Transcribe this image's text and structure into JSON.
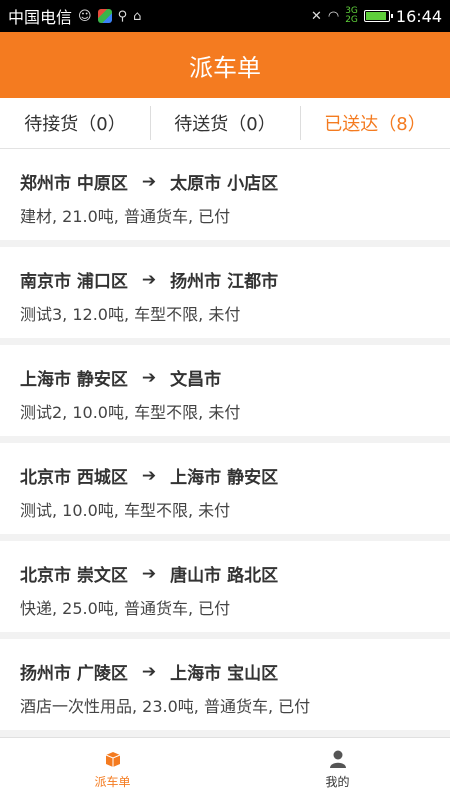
{
  "status_bar": {
    "carrier": "中国电信",
    "time": "16:44",
    "network": [
      "3G",
      "2G"
    ]
  },
  "header": {
    "title": "派车单"
  },
  "tabs": [
    {
      "label": "待接货（0）",
      "active": false
    },
    {
      "label": "待送货（0）",
      "active": false
    },
    {
      "label": "已送达（8）",
      "active": true
    }
  ],
  "orders": [
    {
      "from": "郑州市 中原区",
      "to": "太原市 小店区",
      "detail": "建材, 21.0吨, 普通货车, 已付"
    },
    {
      "from": "南京市 浦口区",
      "to": "扬州市 江都市",
      "detail": "测试3, 12.0吨, 车型不限, 未付"
    },
    {
      "from": "上海市 静安区",
      "to": "文昌市",
      "detail": "测试2, 10.0吨, 车型不限, 未付"
    },
    {
      "from": "北京市 西城区",
      "to": "上海市 静安区",
      "detail": "测试, 10.0吨, 车型不限, 未付"
    },
    {
      "from": "北京市 崇文区",
      "to": "唐山市 路北区",
      "detail": "快递, 25.0吨, 普通货车, 已付"
    },
    {
      "from": "扬州市 广陵区",
      "to": "上海市 宝山区",
      "detail": "酒店一次性用品, 23.0吨, 普通货车, 已付"
    }
  ],
  "arrow": "➔",
  "bottom_nav": [
    {
      "label": "派车单",
      "icon": "truck-box-icon",
      "active": true
    },
    {
      "label": "我的",
      "icon": "user-icon",
      "active": false
    }
  ],
  "colors": {
    "accent": "#f47b20"
  }
}
